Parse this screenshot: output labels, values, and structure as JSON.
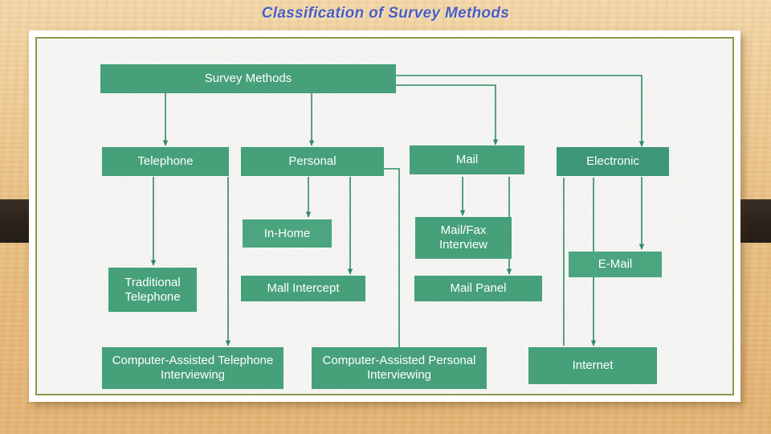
{
  "slide": {
    "title": "Classification of Survey Methods",
    "title_color": "#4a5ec0",
    "background": "wooden-board",
    "frame_border_color": "#8a9a4a",
    "canvas_color": "#f6f6f4"
  },
  "theme": {
    "node_fill": "#46a07a",
    "node_fill_alt": "#3d9778",
    "node_text": "#ffffff",
    "connector_color": "#2f8a68"
  },
  "diagram": {
    "type": "tree",
    "root": "Survey Methods",
    "nodes": [
      {
        "id": "survey-methods",
        "label": "Survey Methods",
        "level": 0
      },
      {
        "id": "telephone",
        "label": "Telephone",
        "level": 1
      },
      {
        "id": "personal",
        "label": "Personal",
        "level": 1
      },
      {
        "id": "mail",
        "label": "Mail",
        "level": 1
      },
      {
        "id": "electronic",
        "label": "Electronic",
        "level": 1
      },
      {
        "id": "in-home",
        "label": "In-Home",
        "level": 2
      },
      {
        "id": "mail-fax",
        "label": "Mail/Fax Interview",
        "level": 2
      },
      {
        "id": "e-mail",
        "label": "E-Mail",
        "level": 2
      },
      {
        "id": "traditional",
        "label": "Traditional Telephone",
        "level": 2
      },
      {
        "id": "mall-intercept",
        "label": "Mall Intercept",
        "level": 2
      },
      {
        "id": "mail-panel",
        "label": "Mail Panel",
        "level": 2
      },
      {
        "id": "cati",
        "label": "Computer-Assisted Telephone Interviewing",
        "level": 2
      },
      {
        "id": "capi",
        "label": "Computer-Assisted Personal Interviewing",
        "level": 2
      },
      {
        "id": "internet",
        "label": "Internet",
        "level": 2
      }
    ],
    "edges": [
      {
        "from": "survey-methods",
        "to": "telephone"
      },
      {
        "from": "survey-methods",
        "to": "personal"
      },
      {
        "from": "survey-methods",
        "to": "mail"
      },
      {
        "from": "survey-methods",
        "to": "electronic"
      },
      {
        "from": "telephone",
        "to": "traditional"
      },
      {
        "from": "telephone",
        "to": "cati"
      },
      {
        "from": "personal",
        "to": "in-home"
      },
      {
        "from": "personal",
        "to": "mall-intercept"
      },
      {
        "from": "personal",
        "to": "capi"
      },
      {
        "from": "mail",
        "to": "mail-fax"
      },
      {
        "from": "mail",
        "to": "mail-panel"
      },
      {
        "from": "electronic",
        "to": "e-mail"
      },
      {
        "from": "electronic",
        "to": "internet"
      }
    ]
  },
  "labels": {
    "survey_methods": "Survey Methods",
    "telephone": "Telephone",
    "personal": "Personal",
    "mail": "Mail",
    "electronic": "Electronic",
    "in_home": "In-Home",
    "mail_fax_interview": "Mail/Fax Interview",
    "e_mail": "E-Mail",
    "traditional_telephone": "Traditional Telephone",
    "mall_intercept": "Mall Intercept",
    "mail_panel": "Mail Panel",
    "cati": "Computer-Assisted Telephone Interviewing",
    "capi": "Computer-Assisted Personal Interviewing",
    "internet": "Internet"
  }
}
